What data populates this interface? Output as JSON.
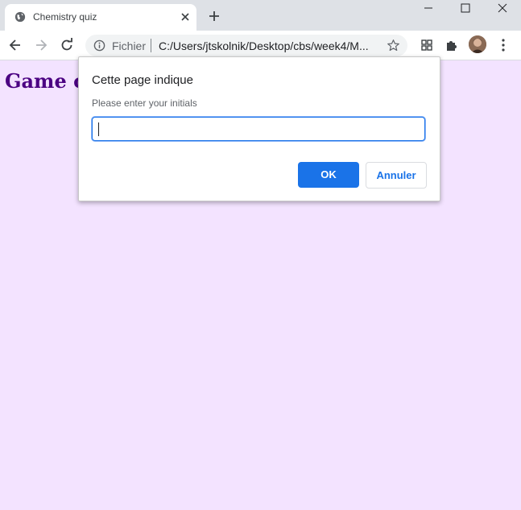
{
  "browser": {
    "tab": {
      "title": "Chemistry quiz",
      "favicon": "globe-icon"
    },
    "address": {
      "scheme_label": "Fichier",
      "url": "C:/Users/jtskolnik/Desktop/cbs/week4/M..."
    },
    "icons": [
      "back-icon",
      "forward-icon",
      "reload-icon",
      "info-icon",
      "star-icon",
      "extension-grid-icon",
      "puzzle-icon",
      "avatar",
      "kebab-menu-icon",
      "minimize-icon",
      "maximize-icon",
      "close-icon",
      "new-tab-icon"
    ]
  },
  "page": {
    "heading": "Game over",
    "background": "#f3e3ff",
    "heading_color": "#4b0082"
  },
  "dialog": {
    "title": "Cette page indique",
    "message": "Please enter your initials",
    "input_value": "",
    "ok_label": "OK",
    "cancel_label": "Annuler",
    "accent": "#1a73e8"
  }
}
